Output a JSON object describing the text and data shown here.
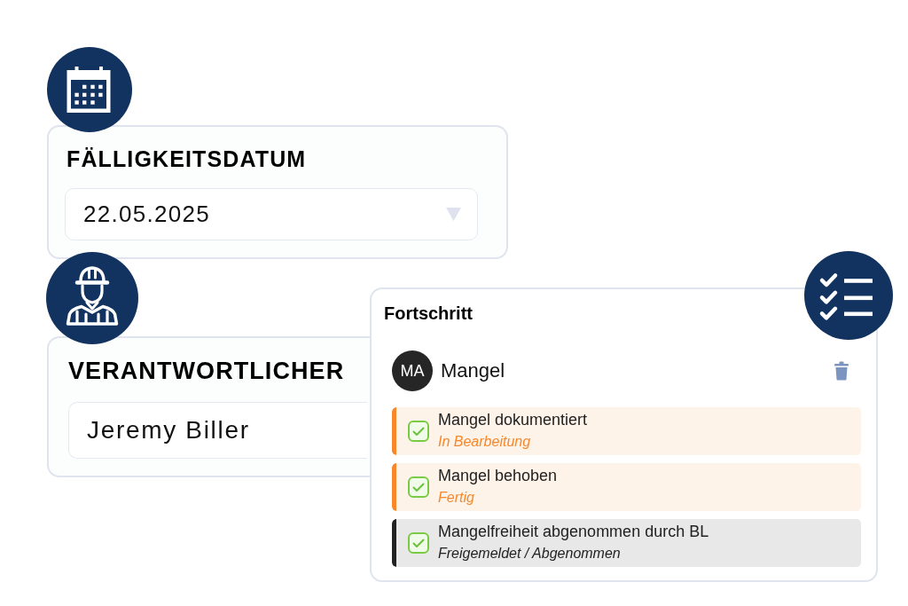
{
  "due_date": {
    "label": "FÄLLIGKEITSDATUM",
    "value": "22.05.2025"
  },
  "responsible": {
    "label": "VERANTWORTLICHER",
    "value": "Jeremy Biller"
  },
  "progress": {
    "title": "Fortschritt",
    "defect": {
      "initials": "MA",
      "name": "Mangel"
    },
    "steps": [
      {
        "title": "Mangel dokumentiert",
        "status": "In Bearbeitung",
        "color": "#f7872b",
        "checked": true
      },
      {
        "title": "Mangel behoben",
        "status": "Fertig",
        "color": "#f7872b",
        "checked": true
      },
      {
        "title": "Mangelfreiheit abgenommen durch BL",
        "status": "Freigemeldet / Abgenommen",
        "color": "#222222",
        "checked": true
      }
    ]
  }
}
